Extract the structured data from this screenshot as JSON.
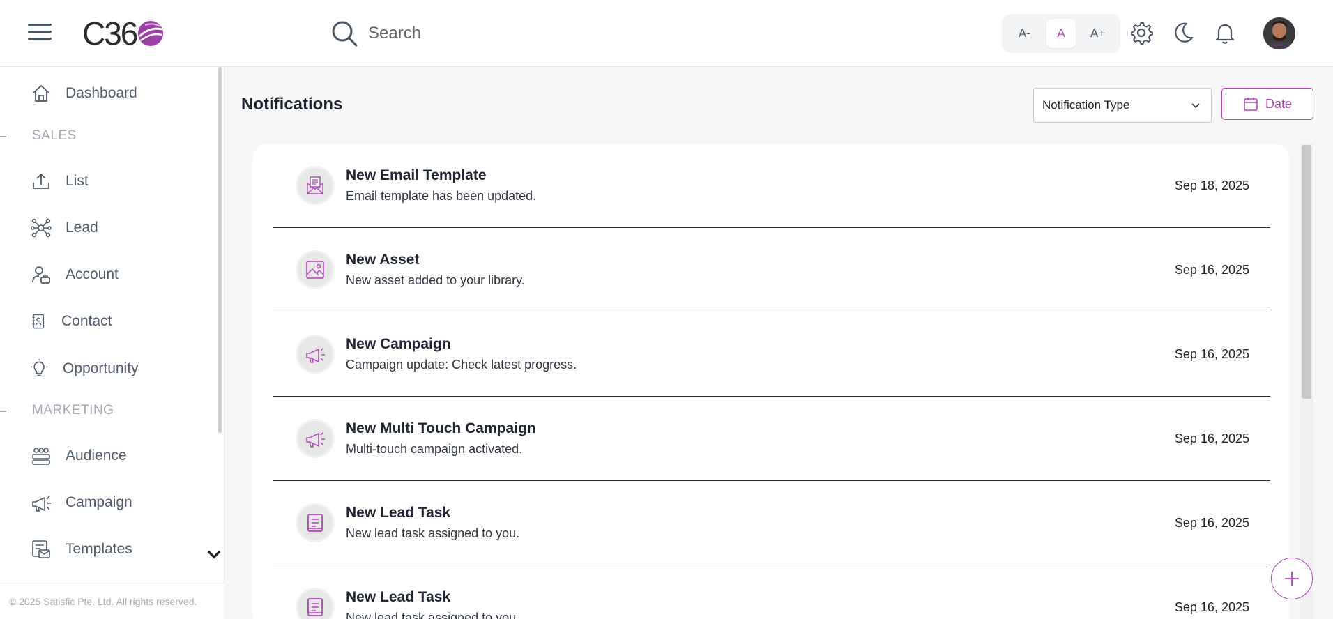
{
  "header": {
    "logo_text": "C36",
    "search_placeholder": "Search",
    "font_sizes": [
      "A-",
      "A",
      "A+"
    ]
  },
  "sidebar": {
    "items": [
      {
        "label": "Dashboard",
        "icon": "home-icon"
      },
      {
        "label": "List",
        "icon": "upload-icon"
      },
      {
        "label": "Lead",
        "icon": "network-icon"
      },
      {
        "label": "Account",
        "icon": "user-briefcase-icon"
      },
      {
        "label": "Contact",
        "icon": "contact-card-icon"
      },
      {
        "label": "Opportunity",
        "icon": "lightbulb-icon"
      },
      {
        "label": "Audience",
        "icon": "group-icon"
      },
      {
        "label": "Campaign",
        "icon": "megaphone-icon"
      },
      {
        "label": "Templates",
        "icon": "template-icon"
      }
    ],
    "sections": [
      "SALES",
      "MARKETING"
    ],
    "footer": "© 2025 Satisfic Pte. Ltd. All rights reserved."
  },
  "main": {
    "title": "Notifications",
    "filter_label": "Notification Type",
    "date_label": "Date",
    "notifications": [
      {
        "title": "New Email Template",
        "desc": "Email template has been updated.",
        "date": "Sep 18, 2025",
        "icon": "email-template-icon"
      },
      {
        "title": "New Asset",
        "desc": "New asset added to your library.",
        "date": "Sep 16, 2025",
        "icon": "image-icon"
      },
      {
        "title": "New Campaign",
        "desc": "Campaign update: Check latest progress.",
        "date": "Sep 16, 2025",
        "icon": "megaphone-icon"
      },
      {
        "title": "New Multi Touch Campaign",
        "desc": "Multi-touch campaign activated.",
        "date": "Sep 16, 2025",
        "icon": "megaphone-icon"
      },
      {
        "title": "New Lead Task",
        "desc": "New lead task assigned to you.",
        "date": "Sep 16, 2025",
        "icon": "task-book-icon"
      },
      {
        "title": "New Lead Task",
        "desc": "New lead task assigned to you.",
        "date": "Sep 16, 2025",
        "icon": "task-book-icon"
      }
    ]
  },
  "colors": {
    "accent": "#b044b8",
    "text_dark": "#1f2533",
    "sidebar_text": "#4f5b6b",
    "section_text": "#a3aab5"
  }
}
